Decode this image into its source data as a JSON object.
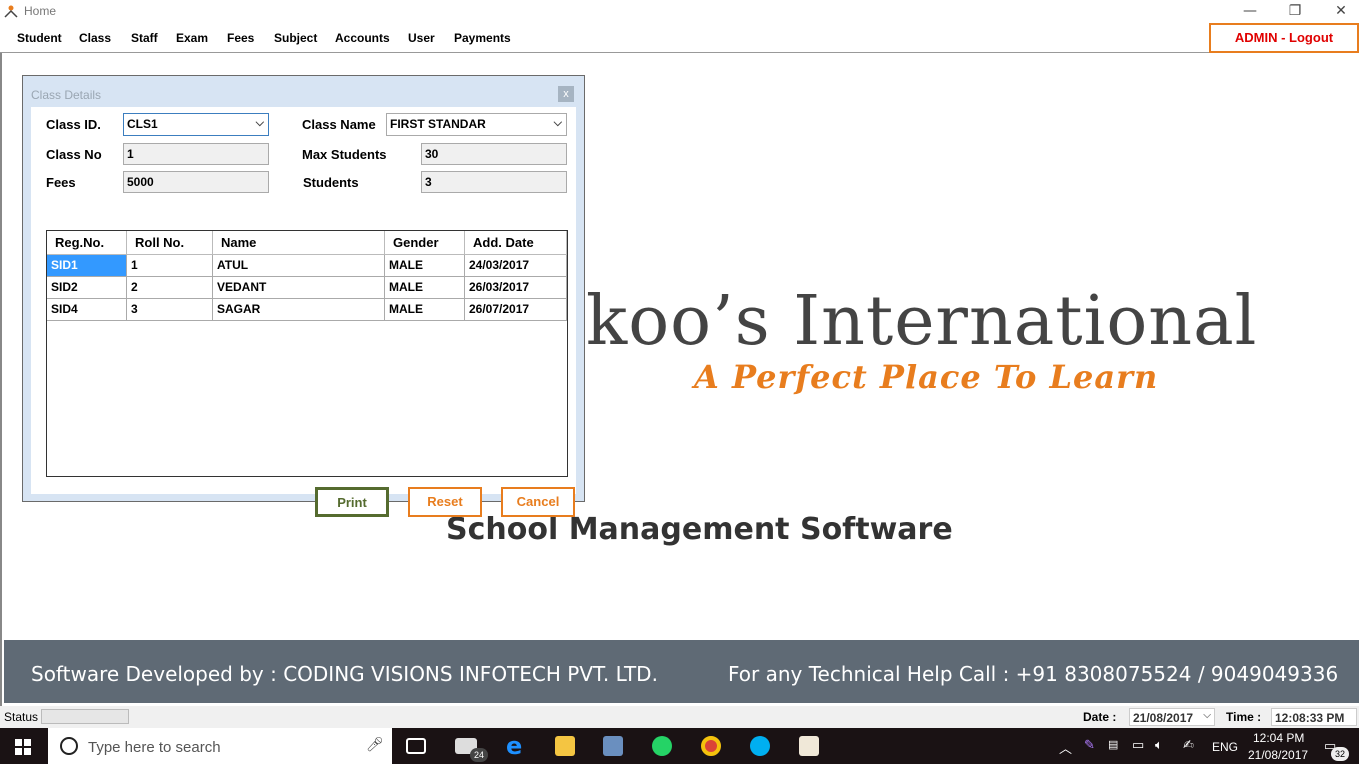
{
  "window": {
    "title": "Home",
    "controls": {
      "minimize": "—",
      "restore": "❐",
      "close": "✕"
    }
  },
  "menu": {
    "items": [
      "Student",
      "Class",
      "Staff",
      "Exam",
      "Fees",
      "Subject",
      "Accounts",
      "User",
      "Payments"
    ],
    "logout_label": "ADMIN - Logout"
  },
  "branding": {
    "logo_line1": "koo’s International",
    "logo_line2": "A Perfect Place To Learn",
    "tagline": "School Management Software"
  },
  "footer": {
    "developer": "Software Developed by : CODING VISIONS INFOTECH PVT. LTD.",
    "help": "For any Technical Help Call : +91 8308075524 / 9049049336"
  },
  "status_bar": {
    "status_label": "Status",
    "date_label": "Date :",
    "date_value": "21/08/2017",
    "time_label": "Time :",
    "time_value": "12:08:33 PM"
  },
  "dialog": {
    "title": "Class Details",
    "close": "x",
    "fields": {
      "class_id_label": "Class ID.",
      "class_id_value": "CLS1",
      "class_name_label": "Class Name",
      "class_name_value": "FIRST STANDAR",
      "class_no_label": "Class No",
      "class_no_value": "1",
      "max_students_label": "Max Students",
      "max_students_value": "30",
      "fees_label": "Fees",
      "fees_value": "5000",
      "students_label": "Students",
      "students_value": "3"
    },
    "table": {
      "columns": [
        "Reg.No.",
        "Roll No.",
        "Name",
        "Gender",
        "Add. Date"
      ],
      "rows": [
        [
          "SID1",
          "1",
          "ATUL",
          "MALE",
          "24/03/2017"
        ],
        [
          "SID2",
          "2",
          "VEDANT",
          "MALE",
          "26/03/2017"
        ],
        [
          "SID4",
          "3",
          "SAGAR",
          "MALE",
          "26/07/2017"
        ]
      ]
    },
    "buttons": {
      "print": "Print",
      "reset": "Reset",
      "cancel": "Cancel"
    }
  },
  "taskbar": {
    "search_placeholder": "Type here to search",
    "mail_badge": "24",
    "language": "ENG",
    "clock_time": "12:04 PM",
    "clock_date": "21/08/2017",
    "notification_count": "32"
  },
  "colors": {
    "accent_orange": "#e87d1e",
    "logout_red": "#e00000",
    "print_green": "#556b2f",
    "selection_blue": "#3399ff",
    "footer_gray": "#5f6a75"
  }
}
